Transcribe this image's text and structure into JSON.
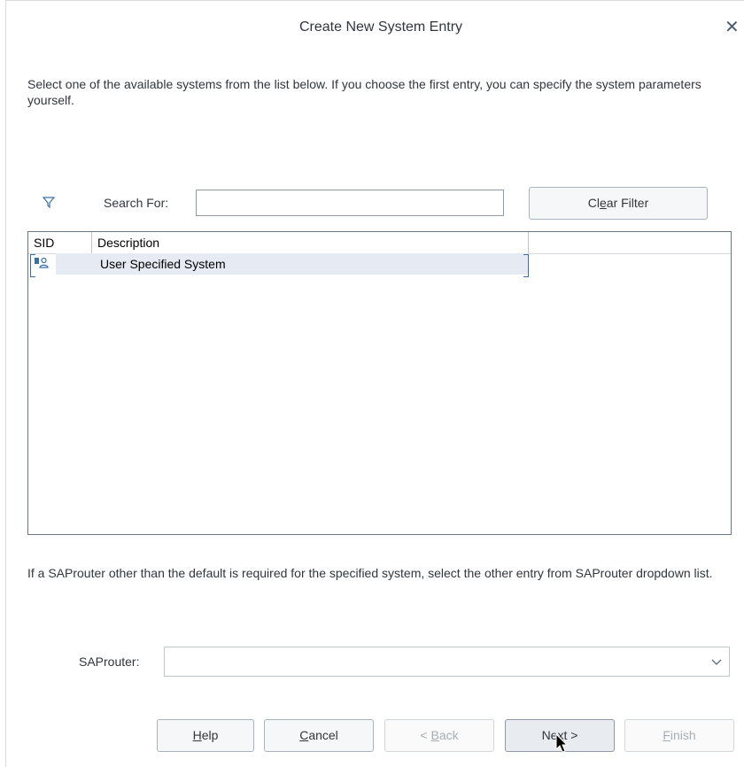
{
  "dialog": {
    "title": "Create New System Entry",
    "close_icon": "close-icon"
  },
  "intro_text": "Select one of the available systems from the list below. If you choose the first entry, you can specify the system parameters yourself.",
  "filter": {
    "icon": "filter-icon",
    "search_label": "Search For:",
    "search_value": "",
    "clear_button_pre": "Cl",
    "clear_button_mnemonic": "e",
    "clear_button_post": "ar Filter"
  },
  "table": {
    "columns": [
      "SID",
      "Description",
      ""
    ],
    "rows": [
      {
        "sid_icon": "user-system-icon",
        "sid": "",
        "description": "User Specified System",
        "selected": true
      }
    ]
  },
  "saprouter": {
    "help_text": "If a SAProuter other than the default is required for the specified system, select the other entry from SAProuter dropdown list.",
    "label": "SAProuter:",
    "selected_value": ""
  },
  "buttons": {
    "help": {
      "mnemonic": "H",
      "rest": "elp"
    },
    "cancel": {
      "mnemonic": "C",
      "rest": "ancel"
    },
    "back": {
      "pre": "< ",
      "mnemonic": "B",
      "rest": "ack"
    },
    "next": {
      "pre": "Ne",
      "mnemonic": "x",
      "rest": "t >"
    },
    "finish": {
      "mnemonic": "F",
      "rest": "inish"
    }
  },
  "colors": {
    "accent": "#3a6fa8",
    "selected_row": "#e5eaf3",
    "text": "#32363a"
  }
}
